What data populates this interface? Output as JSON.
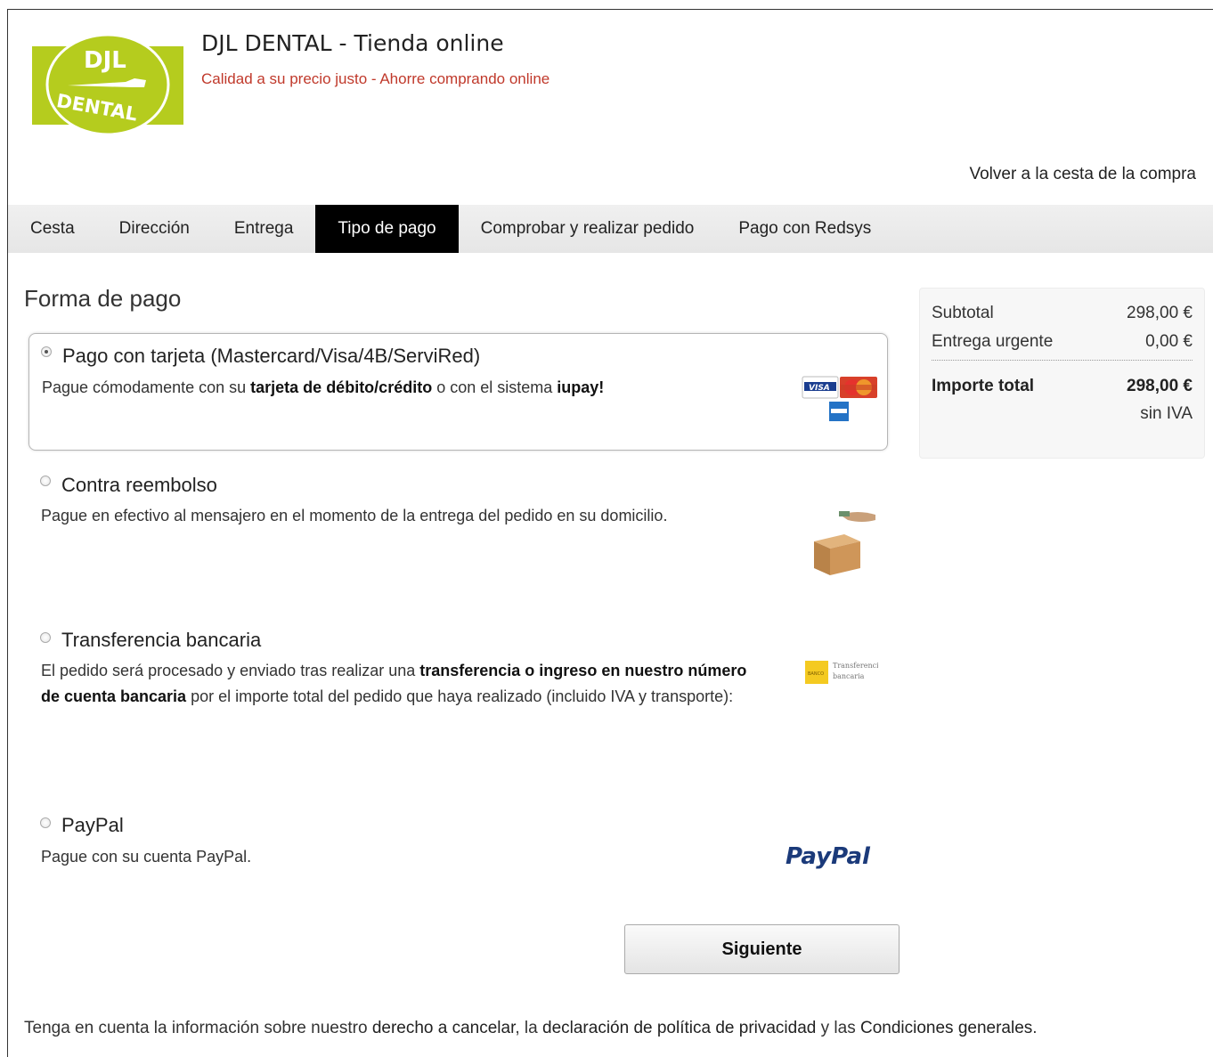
{
  "header": {
    "logo_text_top": "DJL",
    "logo_text_bottom": "DENTAL",
    "title": "DJL DENTAL - Tienda online",
    "tagline": "Calidad a su precio justo - Ahorre comprando online",
    "back_link": "Volver a la cesta de la compra",
    "logo_color": "#b5cc1e"
  },
  "steps": [
    {
      "label": "Cesta",
      "active": false
    },
    {
      "label": "Dirección",
      "active": false
    },
    {
      "label": "Entrega",
      "active": false
    },
    {
      "label": "Tipo de pago",
      "active": true
    },
    {
      "label": "Comprobar y realizar pedido",
      "active": false
    },
    {
      "label": "Pago con Redsys",
      "active": false
    }
  ],
  "main": {
    "section_title": "Forma de pago",
    "methods": [
      {
        "title": "Pago con tarjeta (Mastercard/Visa/4B/ServiRed)",
        "desc_pre": "Pague cómodamente con su ",
        "desc_bold1": "tarjeta de débito/crédito",
        "desc_mid": " o con el sistema ",
        "desc_bold2": "iupay!",
        "selected": true,
        "icon": "credit-cards-icon"
      },
      {
        "title": "Contra reembolso",
        "desc": "Pague en efectivo al mensajero en el momento de la entrega del pedido en su domicilio.",
        "selected": false,
        "icon": "cash-on-delivery-icon"
      },
      {
        "title": "Transferencia bancaria",
        "desc_pre": "El pedido será procesado y enviado tras realizar una ",
        "desc_bold": "transferencia o ingreso en nuestro número de cuenta bancaria",
        "desc_post": " por el importe total del pedido que haya realizado (incluido IVA y transporte):",
        "icon_label1": "BANCO",
        "icon_label2": "Transferencia",
        "icon_label3": "bancaria",
        "selected": false,
        "icon": "bank-transfer-icon"
      },
      {
        "title": "PayPal",
        "desc": "Pague con su cuenta PayPal.",
        "logo_text": "PayPal",
        "selected": false,
        "icon": "paypal-logo"
      }
    ],
    "next_button": "Siguiente"
  },
  "summary": {
    "subtotal_label": "Subtotal",
    "subtotal_value": "298,00 €",
    "shipping_label": "Entrega urgente",
    "shipping_value": "0,00 €",
    "total_label": "Importe total",
    "total_value": "298,00 €",
    "note": "sin IVA"
  },
  "footer": {
    "pre": "Tenga en cuenta la información sobre nuestro ",
    "link1": "derecho a cancelar",
    "sep1": ", la ",
    "link2": "declaración de política de privacidad",
    "sep2": " y las ",
    "link3": "Condiciones generales",
    "post": "."
  }
}
